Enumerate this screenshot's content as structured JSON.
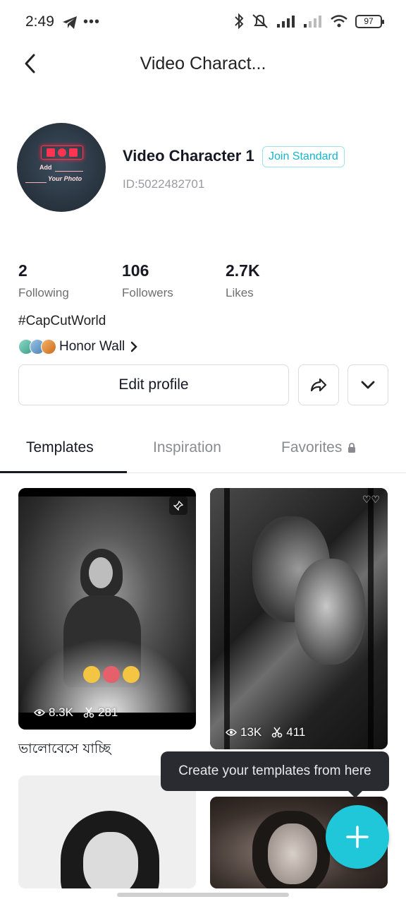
{
  "status_bar": {
    "time": "2:49",
    "battery": "97"
  },
  "header": {
    "title": "Video Charact..."
  },
  "profile": {
    "name": "Video Character 1",
    "badge": "Join Standard",
    "id": "ID:5022482701",
    "avatar_text_top": "Add",
    "avatar_text_bottom": "Your Photo"
  },
  "stats": [
    {
      "value": "2",
      "label": "Following"
    },
    {
      "value": "106",
      "label": "Followers"
    },
    {
      "value": "2.7K",
      "label": "Likes"
    }
  ],
  "bio": "#CapCutWorld",
  "honor_wall": {
    "label": "Honor Wall"
  },
  "actions": {
    "edit_profile": "Edit profile"
  },
  "tabs": [
    {
      "label": "Templates",
      "active": true
    },
    {
      "label": "Inspiration",
      "active": false
    },
    {
      "label": "Favorites",
      "active": false,
      "locked": true
    }
  ],
  "templates": [
    {
      "views": "8.3K",
      "uses": "281",
      "caption": "ভালোবেসে যাচ্ছি",
      "pinned": true
    },
    {
      "views": "13K",
      "uses": "411"
    }
  ],
  "tooltip": "Create your templates from here",
  "colors": {
    "accent": "#1fc7d8",
    "badge_text": "#15b7c9"
  }
}
